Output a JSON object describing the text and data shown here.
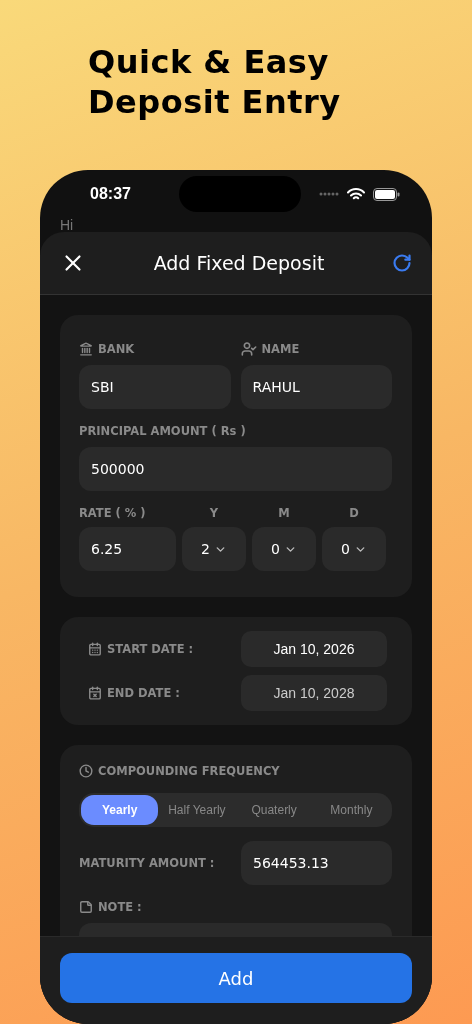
{
  "headline_lines": [
    "Quick & Easy",
    "Deposit Entry"
  ],
  "status_bar": {
    "time": "08:37"
  },
  "background_greeting": "Hi",
  "header": {
    "title": "Add Fixed Deposit"
  },
  "details": {
    "bank": {
      "label": "BANK",
      "value": "SBI"
    },
    "name": {
      "label": "NAME",
      "value": "RAHUL"
    },
    "principal": {
      "label": "PRINCIPAL AMOUNT ( Rs )",
      "value": "500000"
    },
    "rate": {
      "label": "RATE ( % )",
      "value": "6.25"
    },
    "tenure": [
      {
        "label": "Y",
        "value": "2"
      },
      {
        "label": "M",
        "value": "0"
      },
      {
        "label": "D",
        "value": "0"
      }
    ]
  },
  "dates": [
    {
      "kind": "start",
      "label": "START DATE :",
      "value": "Jan 10, 2026"
    },
    {
      "kind": "end",
      "label": "END DATE :",
      "value": "Jan 10, 2028"
    }
  ],
  "compounding": {
    "label": "COMPOUNDING FREQUENCY",
    "options": [
      {
        "label": "Yearly",
        "selected": true
      },
      {
        "label": "Half Yearly",
        "selected": false
      },
      {
        "label": "Quaterly",
        "selected": false
      },
      {
        "label": "Monthly",
        "selected": false
      }
    ]
  },
  "maturity": {
    "label": "MATURITY AMOUNT :",
    "value": "564453.13"
  },
  "note": {
    "label": "NOTE :"
  },
  "add_button": "Add"
}
